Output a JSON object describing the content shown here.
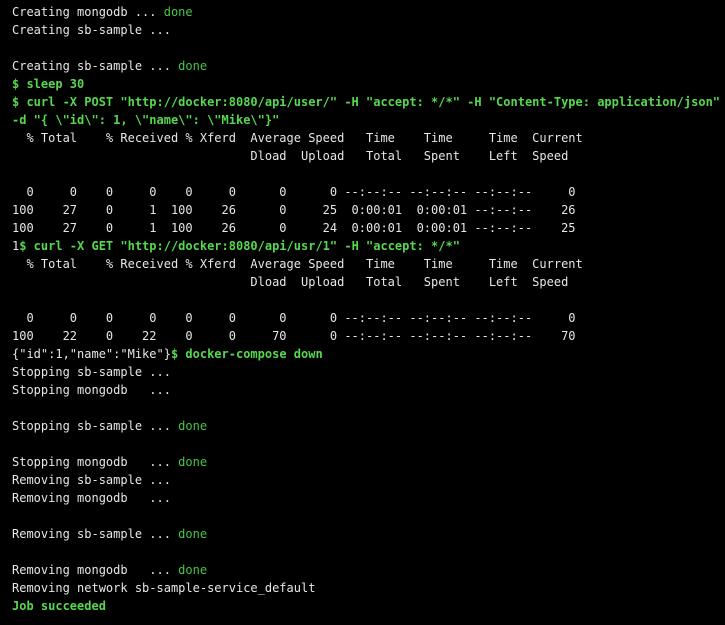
{
  "terminal": {
    "colors": {
      "background": "#000000",
      "text": "#e6e6e6",
      "done": "#49c545",
      "command": "#56d84e"
    },
    "lines": [
      [
        {
          "t": "Creating mongodb ... ",
          "c": "white"
        },
        {
          "t": "done",
          "c": "green"
        }
      ],
      [
        {
          "t": "Creating sb-sample ...",
          "c": "white"
        }
      ],
      [
        {
          "t": "",
          "c": "white"
        }
      ],
      [
        {
          "t": "Creating sb-sample ... ",
          "c": "white"
        },
        {
          "t": "done",
          "c": "green"
        }
      ],
      [
        {
          "t": "$ sleep 30",
          "c": "bright"
        }
      ],
      [
        {
          "t": "$ curl -X POST \"http://docker:8080/api/user/\" -H \"accept: */*\" -H \"Content-Type: application/json\"",
          "c": "bright"
        }
      ],
      [
        {
          "t": "-d \"{ \\\"id\\\": 1, \\\"name\\\": \\\"Mike\\\"}\"",
          "c": "bright"
        }
      ],
      [
        {
          "t": "  % Total    % Received % Xferd  Average Speed   Time    Time     Time  Current",
          "c": "white"
        }
      ],
      [
        {
          "t": "                                 Dload  Upload   Total   Spent    Left  Speed",
          "c": "white"
        }
      ],
      [
        {
          "t": "",
          "c": "white"
        }
      ],
      [
        {
          "t": "  0     0    0     0    0     0      0      0 --:--:-- --:--:-- --:--:--     0",
          "c": "white"
        }
      ],
      [
        {
          "t": "100    27    0     1  100    26      0     25  0:00:01  0:00:01 --:--:--    26",
          "c": "white"
        }
      ],
      [
        {
          "t": "100    27    0     1  100    26      0     24  0:00:01  0:00:01 --:--:--    25",
          "c": "white"
        }
      ],
      [
        {
          "t": "1",
          "c": "white"
        },
        {
          "t": "$ curl -X GET \"http://docker:8080/api/usr/1\" -H \"accept: */*\"",
          "c": "bright"
        }
      ],
      [
        {
          "t": "  % Total    % Received % Xferd  Average Speed   Time    Time     Time  Current",
          "c": "white"
        }
      ],
      [
        {
          "t": "                                 Dload  Upload   Total   Spent    Left  Speed",
          "c": "white"
        }
      ],
      [
        {
          "t": "",
          "c": "white"
        }
      ],
      [
        {
          "t": "  0     0    0     0    0     0      0      0 --:--:-- --:--:-- --:--:--     0",
          "c": "white"
        }
      ],
      [
        {
          "t": "100    22    0    22    0     0     70      0 --:--:-- --:--:-- --:--:--    70",
          "c": "white"
        }
      ],
      [
        {
          "t": "{\"id\":1,\"name\":\"Mike\"}",
          "c": "white"
        },
        {
          "t": "$ docker-compose down",
          "c": "bright"
        }
      ],
      [
        {
          "t": "Stopping sb-sample ...",
          "c": "white"
        }
      ],
      [
        {
          "t": "Stopping mongodb   ...",
          "c": "white"
        }
      ],
      [
        {
          "t": "",
          "c": "white"
        }
      ],
      [
        {
          "t": "Stopping sb-sample ... ",
          "c": "white"
        },
        {
          "t": "done",
          "c": "green"
        }
      ],
      [
        {
          "t": "",
          "c": "white"
        }
      ],
      [
        {
          "t": "Stopping mongodb   ... ",
          "c": "white"
        },
        {
          "t": "done",
          "c": "green"
        }
      ],
      [
        {
          "t": "Removing sb-sample ...",
          "c": "white"
        }
      ],
      [
        {
          "t": "Removing mongodb   ...",
          "c": "white"
        }
      ],
      [
        {
          "t": "",
          "c": "white"
        }
      ],
      [
        {
          "t": "Removing sb-sample ... ",
          "c": "white"
        },
        {
          "t": "done",
          "c": "green"
        }
      ],
      [
        {
          "t": "",
          "c": "white"
        }
      ],
      [
        {
          "t": "Removing mongodb   ... ",
          "c": "white"
        },
        {
          "t": "done",
          "c": "green"
        }
      ],
      [
        {
          "t": "Removing network sb-sample-service_default",
          "c": "white"
        }
      ],
      [
        {
          "t": "Job succeeded",
          "c": "bright"
        }
      ]
    ]
  }
}
